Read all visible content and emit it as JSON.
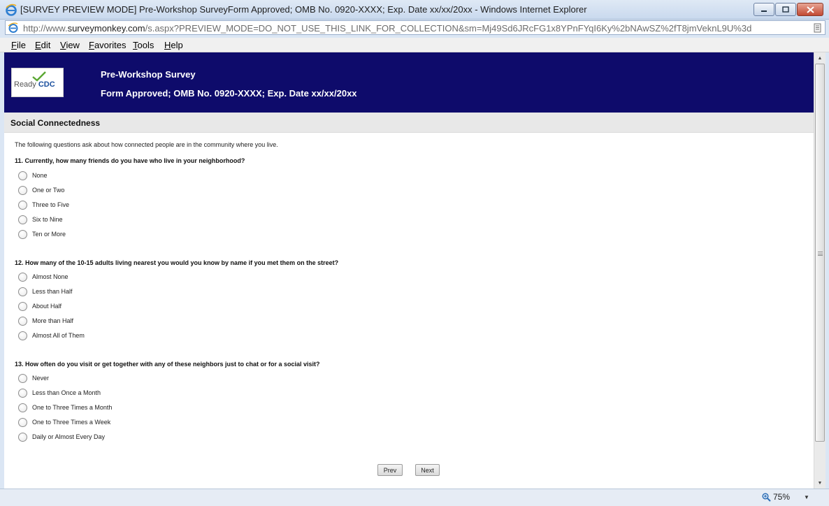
{
  "window": {
    "title": "[SURVEY PREVIEW MODE] Pre-Workshop SurveyForm Approved; OMB No. 0920-XXXX; Exp. Date xx/xx/20xx - Windows Internet Explorer"
  },
  "address": {
    "url_prefix": "http://www.",
    "url_domain": "surveymonkey.com",
    "url_path": "/s.aspx?PREVIEW_MODE=DO_NOT_USE_THIS_LINK_FOR_COLLECTION&sm=Mj49Sd6JRcFG1x8YPnFYqI6Ky%2bNAwSZ%2fT8jmVeknL9U%3d"
  },
  "menu": [
    "File",
    "Edit",
    "View",
    "Favorites",
    "Tools",
    "Help"
  ],
  "banner": {
    "logo_text_1": "Ready",
    "logo_text_2": "CDC",
    "title": "Pre-Workshop Survey",
    "subtitle": "Form Approved; OMB No. 0920-XXXX; Exp. Date xx/xx/20xx"
  },
  "section": {
    "title": "Social Connectedness",
    "intro": "The following questions ask about how connected people are in the community where you live."
  },
  "questions": [
    {
      "text": "11. Currently, how many friends do you have who live in your neighborhood?",
      "options": [
        "None",
        "One or Two",
        "Three to Five",
        "Six to Nine",
        "Ten or More"
      ]
    },
    {
      "text": "12. How many of the 10-15 adults living nearest you would you know by name if you met them on the street?",
      "options": [
        "Almost None",
        "Less than Half",
        "About Half",
        "More than Half",
        "Almost All of Them"
      ]
    },
    {
      "text": "13. How often do you visit or get together with any of these neighbors just to chat or for a social visit?",
      "options": [
        "Never",
        "Less than Once a Month",
        "One to Three Times a Month",
        "One to Three Times a Week",
        "Daily or Almost Every Day"
      ]
    }
  ],
  "nav": {
    "prev": "Prev",
    "next": "Next"
  },
  "status": {
    "zoom": "75%"
  },
  "colors": {
    "banner": "#0e0b6b",
    "section_bar": "#e8e8e8"
  }
}
